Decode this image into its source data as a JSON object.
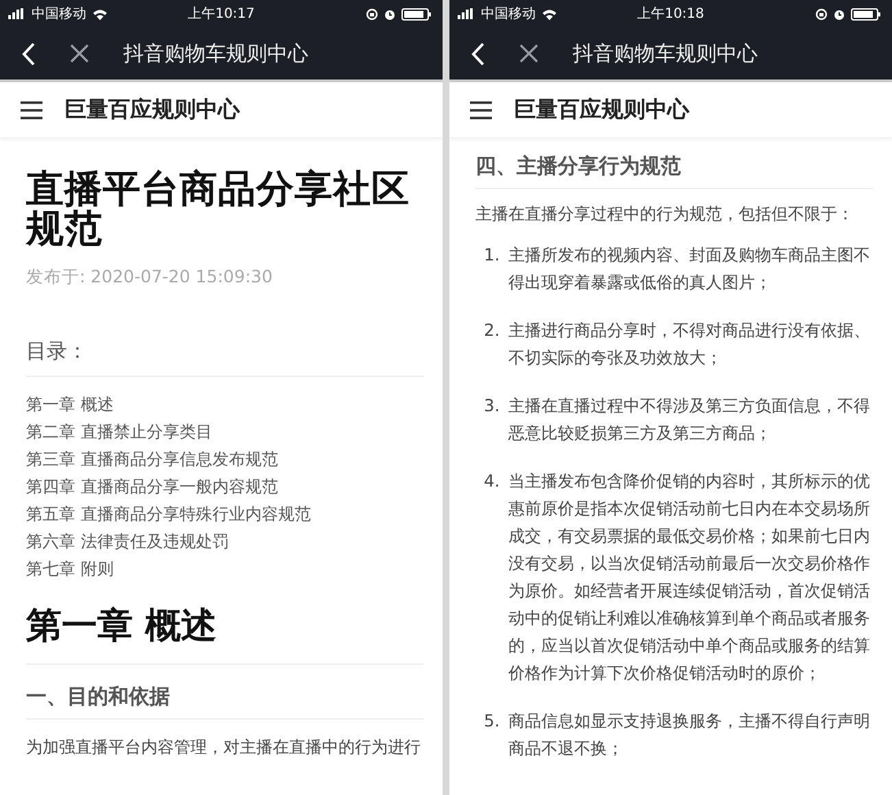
{
  "panels": [
    {
      "status_bar": {
        "carrier": "中国移动",
        "time": "上午10:17"
      },
      "nav_bar": {
        "title": "抖音购物车规则中心"
      },
      "header": {
        "title": "巨量百应规则中心"
      },
      "blocks": [
        {
          "kind": "title",
          "text": "直播平台商品分享社区规范"
        },
        {
          "kind": "date",
          "text": "发布于: 2020-07-20 15:09:30"
        },
        {
          "kind": "toc_heading",
          "text": "目录："
        },
        {
          "kind": "toc",
          "items": [
            "第一章 概述",
            "第二章 直播禁止分享类目",
            "第三章 直播商品分享信息发布规范",
            "第四章 直播商品分享一般内容规范",
            "第五章 直播商品分享特殊行业内容规范",
            "第六章 法律责任及违规处罚",
            "第七章 附则"
          ]
        },
        {
          "kind": "chapter",
          "text": "第一章 概述"
        },
        {
          "kind": "section",
          "text": "一、目的和依据"
        },
        {
          "kind": "paragraph",
          "text": "为加强直播平台内容管理，对主播在直播中的行为进行"
        }
      ]
    },
    {
      "status_bar": {
        "carrier": "中国移动",
        "time": "上午10:18"
      },
      "nav_bar": {
        "title": "抖音购物车规则中心"
      },
      "header": {
        "title": "巨量百应规则中心"
      },
      "blocks": [
        {
          "kind": "section",
          "text": "四、主播分享行为规范"
        },
        {
          "kind": "paragraph",
          "text": "主播在直播分享过程中的行为规范，包括但不限于："
        },
        {
          "kind": "list",
          "items": [
            {
              "number": "1.",
              "text": "主播所发布的视频内容、封面及购物车商品主图不得出现穿着暴露或低俗的真人图片；"
            },
            {
              "number": "2.",
              "text": "主播进行商品分享时，不得对商品进行没有依据、不切实际的夸张及功效放大；"
            },
            {
              "number": "3.",
              "text": "主播在直播过程中不得涉及第三方负面信息，不得恶意比较贬损第三方及第三方商品；"
            },
            {
              "number": "4.",
              "text": "当主播发布包含降价促销的内容时，其所标示的优惠前原价是指本次促销活动前七日内在本交易场所成交，有交易票据的最低交易价格；如果前七日内没有交易，以当次促销活动前最后一次交易价格作为原价。如经营者开展连续促销活动，首次促销活动中的促销让利难以准确核算到单个商品或者服务的，应当以首次促销活动中单个商品或服务的结算价格作为计算下次价格促销活动时的原价；"
            },
            {
              "number": "5.",
              "text": "商品信息如显示支持退换服务，主播不得自行声明商品不退不换；"
            }
          ]
        }
      ]
    }
  ]
}
